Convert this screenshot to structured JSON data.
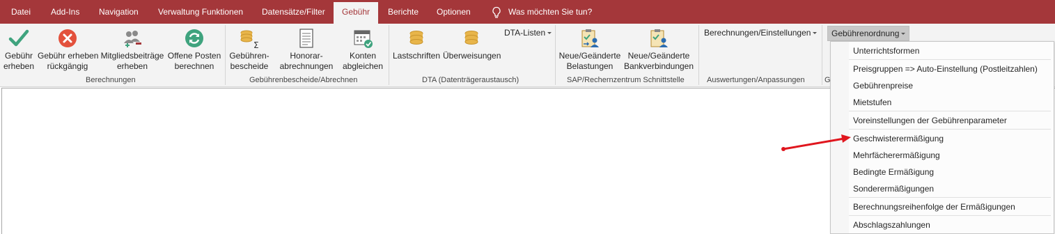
{
  "tabs": [
    {
      "label": "Datei"
    },
    {
      "label": "Add-Ins"
    },
    {
      "label": "Navigation"
    },
    {
      "label": "Verwaltung Funktionen"
    },
    {
      "label": "Datensätze/Filter"
    },
    {
      "label": "Gebühr"
    },
    {
      "label": "Berichte"
    },
    {
      "label": "Optionen"
    }
  ],
  "active_tab": "Gebühr",
  "tell_me": "Was möchten Sie tun?",
  "ribbon": {
    "buttons": [
      {
        "line1": "Gebühr",
        "line2": "erheben",
        "icon": "checkmark-icon"
      },
      {
        "line1": "Gebühr erheben",
        "line2": "rückgängig",
        "icon": "cancel-circle-icon"
      },
      {
        "line1": "Mitgliedsbeiträge",
        "line2": "erheben",
        "icon": "members-icon"
      },
      {
        "line1": "Offene Posten",
        "line2": "berechnen",
        "icon": "refresh-icon"
      },
      {
        "line1": "Gebühren-",
        "line2": "bescheide",
        "icon": "coins-sum-icon"
      },
      {
        "line1": "Honorar-",
        "line2": "abrechnungen",
        "icon": "document-icon"
      },
      {
        "line1": "Konten",
        "line2": "abgleichen",
        "icon": "calendar-check-icon"
      },
      {
        "line1": "Lastschriften",
        "line2": "",
        "icon": "coins-icon"
      },
      {
        "line1": "Überweisungen",
        "line2": "",
        "icon": "coins-icon"
      },
      {
        "line1": "Neue/Geänderte",
        "line2": "Belastungen",
        "icon": "clipboard-user-icon"
      },
      {
        "line1": "Neue/Geänderte",
        "line2": "Bankverbindungen",
        "icon": "clipboard-user-icon"
      }
    ],
    "dta_listen": "DTA-Listen",
    "berechnungen_einstellungen": "Berechnungen/Einstellungen",
    "gebuehrenordnung": "Gebührenordnung",
    "groups": [
      {
        "label": "Berechnungen"
      },
      {
        "label": "Gebührenbescheide/Abrechnen"
      },
      {
        "label": "DTA (Datenträgeraustausch)"
      },
      {
        "label": "SAP/Rechernzentrum Schnittstelle"
      },
      {
        "label": "Auswertungen/Anpassungen"
      },
      {
        "label": "G"
      }
    ]
  },
  "menu": {
    "items": [
      {
        "label": "Unterrichtsformen"
      },
      {
        "label": "Preisgruppen => Auto-Einstellung (Postleitzahlen)"
      },
      {
        "label": "Gebührenpreise"
      },
      {
        "label": "Mietstufen"
      },
      {
        "label": "Voreinstellungen der Gebührenparameter"
      },
      {
        "label": "Geschwisterermäßigung"
      },
      {
        "label": "Mehrfächerermäßigung"
      },
      {
        "label": "Bedingte Ermäßigung"
      },
      {
        "label": "Sonderermäßigungen"
      },
      {
        "label": "Berechnungsreihenfolge der Ermäßigungen"
      },
      {
        "label": "Abschlagszahlungen"
      }
    ]
  },
  "colors": {
    "accent": "#a4373a",
    "ribbon_bg": "#f3f3f3",
    "check_green": "#3fa37e",
    "cancel_red": "#e3513c",
    "coin_gold": "#e8b54a",
    "arrow_red": "#e0161e"
  }
}
